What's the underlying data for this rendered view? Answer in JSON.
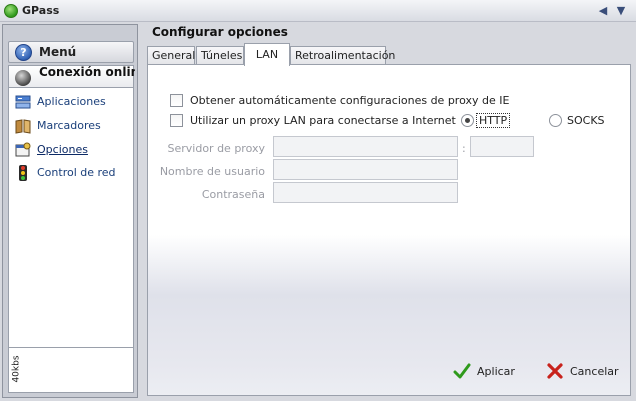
{
  "window": {
    "title": "GPass",
    "app_icon": "gpass-globe-icon",
    "controls": [
      "collapse-left-icon",
      "dropdown-icon"
    ]
  },
  "sidebar": {
    "menu_label": "Menú",
    "menu_icon": "help-icon",
    "section_label": "Conexión online segura",
    "section_icon": "globe-plug-icon",
    "items": [
      {
        "label": "Aplicaciones",
        "icon": "applications-icon",
        "active": false
      },
      {
        "label": "Marcadores",
        "icon": "bookmarks-icon",
        "active": false
      },
      {
        "label": "Opciones",
        "icon": "options-icon",
        "active": true
      },
      {
        "label": "Control de red",
        "icon": "traffic-light-icon",
        "active": false
      }
    ],
    "speed_label": "40kbs"
  },
  "main": {
    "title": "Configurar opciones",
    "tabs": [
      {
        "label": "General",
        "active": false
      },
      {
        "label": "Túneles",
        "active": false
      },
      {
        "label": "LAN",
        "active": true
      },
      {
        "label": "Retroalimentación",
        "active": false
      }
    ],
    "lan": {
      "auto_proxy_label": "Obtener automáticamente configuraciones de proxy de IE",
      "auto_proxy_checked": false,
      "use_proxy_label": "Utilizar un proxy LAN para conectarse a Internet",
      "use_proxy_checked": false,
      "protocol_options": [
        "HTTP",
        "SOCKS"
      ],
      "protocol_selected": "HTTP",
      "server_label": "Servidor de proxy",
      "server_value": "",
      "port_separator": ":",
      "port_value": "",
      "username_label": "Nombre de usuario",
      "username_value": "",
      "password_label": "Contraseña",
      "password_value": ""
    },
    "buttons": {
      "apply_label": "Aplicar",
      "apply_icon": "checkmark-icon",
      "cancel_label": "Cancelar",
      "cancel_icon": "red-x-icon"
    }
  },
  "colors": {
    "link": "#1a3f7a",
    "accent_check": "#2f9a1c",
    "cancel_red": "#c8221c",
    "disabled_text": "#9a9ca4"
  }
}
